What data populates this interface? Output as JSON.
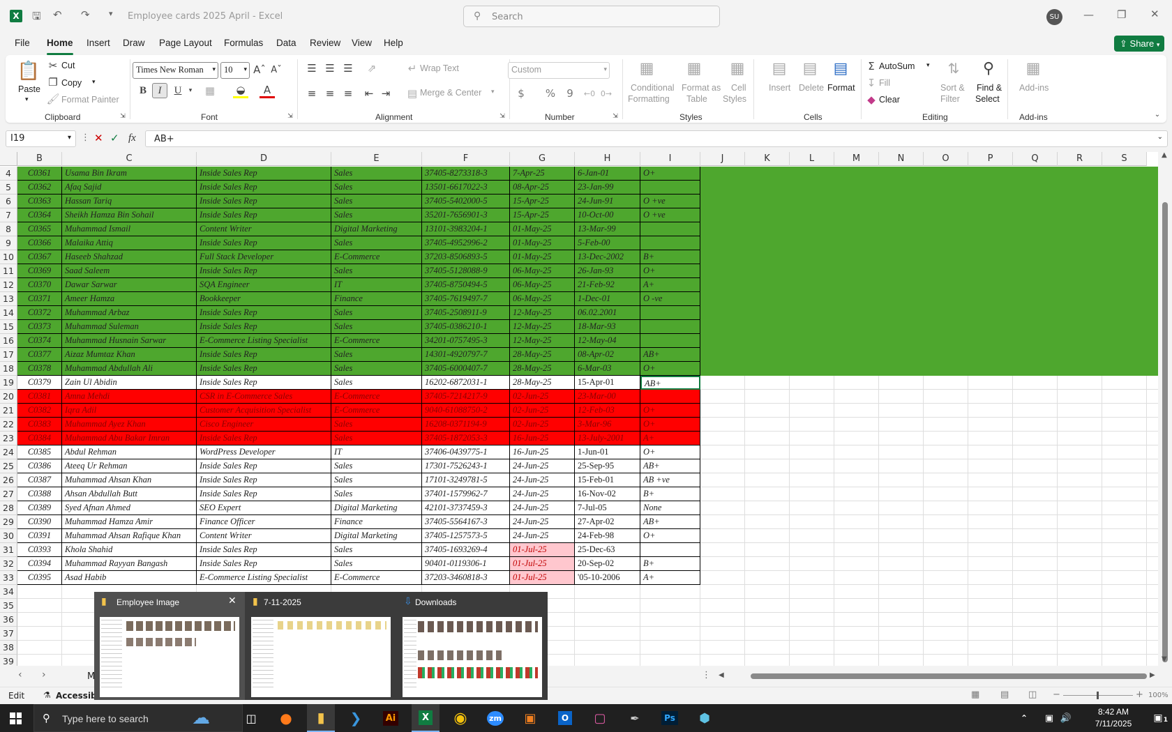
{
  "window": {
    "title": "Employee cards 2025 April  -  Excel",
    "search_placeholder": "Search",
    "user_initials": "SU",
    "share_label": "Share"
  },
  "menu": [
    "File",
    "Home",
    "Insert",
    "Draw",
    "Page Layout",
    "Formulas",
    "Data",
    "Review",
    "View",
    "Help"
  ],
  "ribbon": {
    "clipboard": {
      "paste": "Paste",
      "cut": "Cut",
      "copy": "Copy",
      "format_painter": "Format Painter",
      "group": "Clipboard"
    },
    "font": {
      "name": "Times New Roman",
      "size": "10",
      "group": "Font",
      "bold": "B",
      "italic": "I",
      "underline": "U"
    },
    "alignment": {
      "wrap": "Wrap Text",
      "merge": "Merge & Center",
      "group": "Alignment"
    },
    "number": {
      "format": "Custom",
      "group": "Number",
      "currency": "$",
      "percent": "%",
      "comma": "9"
    },
    "styles": {
      "conditional_1": "Conditional",
      "conditional_2": "Formatting",
      "format_table_1": "Format as",
      "format_table_2": "Table",
      "cell_styles_1": "Cell",
      "cell_styles_2": "Styles",
      "group": "Styles"
    },
    "cells": {
      "insert": "Insert",
      "delete": "Delete",
      "format": "Format",
      "group": "Cells"
    },
    "editing": {
      "autosum": "AutoSum",
      "fill": "Fill",
      "clear": "Clear",
      "sort_1": "Sort &",
      "sort_2": "Filter",
      "find_1": "Find &",
      "find_2": "Select",
      "group": "Editing"
    },
    "addins": {
      "label": "Add-ins",
      "group": "Add-ins"
    }
  },
  "formula": {
    "name_box": "I19",
    "fx": "fx",
    "value": "AB+"
  },
  "columns": [
    "B",
    "C",
    "D",
    "E",
    "F",
    "G",
    "H",
    "I",
    "J",
    "K",
    "L",
    "M",
    "N",
    "O",
    "P",
    "Q",
    "R",
    "S"
  ],
  "rows": [
    {
      "n": "4",
      "b": "C0361",
      "c": "Usama Bin Ikram",
      "d": "Inside Sales Rep",
      "e": "Sales",
      "f": "37405-8273318-3",
      "g": "7-Apr-25",
      "h": "6-Jan-01",
      "i": "O+",
      "fill": "green"
    },
    {
      "n": "5",
      "b": "C0362",
      "c": "Afaq Sajid",
      "d": "Inside Sales Rep",
      "e": "Sales",
      "f": "13501-6617022-3",
      "g": "08-Apr-25",
      "h": "23-Jan-99",
      "i": "",
      "fill": "green"
    },
    {
      "n": "6",
      "b": "C0363",
      "c": "Hassan Tariq",
      "d": "Inside Sales Rep",
      "e": "Sales",
      "f": "37405-5402000-5",
      "g": "15-Apr-25",
      "h": "24-Jun-91",
      "i": "O +ve",
      "fill": "green"
    },
    {
      "n": "7",
      "b": "C0364",
      "c": "Sheikh Hamza Bin Sohail",
      "d": "Inside Sales Rep",
      "e": "Sales",
      "f": "35201-7656901-3",
      "g": "15-Apr-25",
      "h": "10-Oct-00",
      "i": "O +ve",
      "fill": "green"
    },
    {
      "n": "8",
      "b": "C0365",
      "c": "Muhammad Ismail",
      "d": "Content Writer",
      "e": "Digital Marketing",
      "f": "13101-3983204-1",
      "g": "01-May-25",
      "h": "13-Mar-99",
      "i": "",
      "fill": "green"
    },
    {
      "n": "9",
      "b": "C0366",
      "c": "Malaika Attiq",
      "d": "Inside Sales Rep",
      "e": "Sales",
      "f": "37405-4952996-2",
      "g": "01-May-25",
      "h": "5-Feb-00",
      "i": "",
      "fill": "green"
    },
    {
      "n": "10",
      "b": "C0367",
      "c": "Haseeb Shahzad",
      "d": "Full Stack Developer",
      "e": "E-Commerce",
      "f": "37203-8506893-5",
      "g": "01-May-25",
      "h": "13-Dec-2002",
      "i": "B+",
      "fill": "green"
    },
    {
      "n": "11",
      "b": "C0369",
      "c": "Saad Saleem",
      "d": "Inside Sales Rep",
      "e": "Sales",
      "f": "37405-5128088-9",
      "g": "06-May-25",
      "h": "26-Jan-93",
      "i": "O+",
      "fill": "green"
    },
    {
      "n": "12",
      "b": "C0370",
      "c": "Dawar Sarwar",
      "d": "SQA Engineer",
      "e": "IT",
      "f": "37405-8750494-5",
      "g": "06-May-25",
      "h": "21-Feb-92",
      "i": "A+",
      "fill": "green"
    },
    {
      "n": "13",
      "b": "C0371",
      "c": "Ameer Hamza",
      "d": "Bookkeeper",
      "e": "Finance",
      "f": "37405-7619497-7",
      "g": "06-May-25",
      "h": "1-Dec-01",
      "i": "O -ve",
      "fill": "green"
    },
    {
      "n": "14",
      "b": "C0372",
      "c": "Muhammad Arbaz",
      "d": "Inside Sales Rep",
      "e": "Sales",
      "f": "37405-2508911-9",
      "g": "12-May-25",
      "h": "06.02.2001",
      "i": "",
      "fill": "green"
    },
    {
      "n": "15",
      "b": "C0373",
      "c": "Muhammad Suleman",
      "d": "Inside Sales Rep",
      "e": "Sales",
      "f": "37405-0386210-1",
      "g": "12-May-25",
      "h": "18-Mar-93",
      "i": "",
      "fill": "green"
    },
    {
      "n": "16",
      "b": "C0374",
      "c": "Muhammad Husnain Sarwar",
      "d": "E-Commerce Listing Specialist",
      "e": "E-Commerce",
      "f": "34201-0757495-3",
      "g": "12-May-25",
      "h": "12-May-04",
      "i": "",
      "fill": "green"
    },
    {
      "n": "17",
      "b": "C0377",
      "c": "Aizaz Mumtaz Khan",
      "d": "Inside Sales Rep",
      "e": "Sales",
      "f": "14301-4920797-7",
      "g": "28-May-25",
      "h": "08-Apr-02",
      "i": "AB+",
      "fill": "green"
    },
    {
      "n": "18",
      "b": "C0378",
      "c": "Muhammad Abdullah Ali",
      "d": "Inside Sales Rep",
      "e": "Sales",
      "f": "37405-6000407-7",
      "g": "28-May-25",
      "h": "6-Mar-03",
      "i": "O+",
      "fill": "green"
    },
    {
      "n": "19",
      "b": "C0379",
      "c": "Zain Ul Abidin",
      "d": "Inside Sales Rep",
      "e": "Sales",
      "f": "16202-6872031-1",
      "g": "28-May-25",
      "h": "15-Apr-01",
      "i": "AB+",
      "fill": "white"
    },
    {
      "n": "20",
      "b": "C0381",
      "c": "Amna Mehdi",
      "d": "CSR in E-Commerce Sales",
      "e": "E-Commerce",
      "f": "37405-7214217-9",
      "g": "02-Jun-25",
      "h": "23-Mar-00",
      "i": "",
      "fill": "red"
    },
    {
      "n": "21",
      "b": "C0382",
      "c": "Iqra Adil",
      "d": "Customer Acquisition Specialist",
      "e": "E-Commerce",
      "f": "9040-61088750-2",
      "g": "02-Jun-25",
      "h": "12-Feb-03",
      "i": "O+",
      "fill": "red"
    },
    {
      "n": "22",
      "b": "C0383",
      "c": "Muhammad Ayez Khan",
      "d": "Cisco Engineer",
      "e": "Sales",
      "f": "16208-0371194-9",
      "g": "02-Jun-25",
      "h": "3-Mar-96",
      "i": "O+",
      "fill": "red"
    },
    {
      "n": "23",
      "b": "C0384",
      "c": "Muhammad Abu Bakar Imran",
      "d": "Inside Sales Rep",
      "e": "Sales",
      "f": "37405-1872053-3",
      "g": "16-Jun-25",
      "h": "13-July-2001",
      "i": "A+",
      "fill": "red"
    },
    {
      "n": "24",
      "b": "C0385",
      "c": "Abdul Rehman",
      "d": "WordPress Developer",
      "e": "IT",
      "f": "37406-0439775-1",
      "g": "16-Jun-25",
      "h": "1-Jun-01",
      "i": "O+",
      "fill": "white"
    },
    {
      "n": "25",
      "b": "C0386",
      "c": "Ateeq Ur Rehman",
      "d": "Inside Sales Rep",
      "e": "Sales",
      "f": "17301-7526243-1",
      "g": "24-Jun-25",
      "h": "25-Sep-95",
      "i": "AB+",
      "fill": "white"
    },
    {
      "n": "26",
      "b": "C0387",
      "c": "Muhammad Ahsan Khan",
      "d": "Inside Sales Rep",
      "e": "Sales",
      "f": "17101-3249781-5",
      "g": "24-Jun-25",
      "h": "15-Feb-01",
      "i": "AB +ve",
      "fill": "white"
    },
    {
      "n": "27",
      "b": "C0388",
      "c": "Ahsan Abdullah Butt",
      "d": "Inside Sales Rep",
      "e": "Sales",
      "f": "37401-1579962-7",
      "g": "24-Jun-25",
      "h": "16-Nov-02",
      "i": "B+",
      "fill": "white"
    },
    {
      "n": "28",
      "b": "C0389",
      "c": "Syed Afnan Ahmed",
      "d": "SEO Expert",
      "e": "Digital Marketing",
      "f": "42101-3737459-3",
      "g": "24-Jun-25",
      "h": "7-Jul-05",
      "i": "None",
      "fill": "white"
    },
    {
      "n": "29",
      "b": "C0390",
      "c": "Muhammad Hamza Amir",
      "d": "Finance Officer",
      "e": "Finance",
      "f": "37405-5564167-3",
      "g": "24-Jun-25",
      "h": "27-Apr-02",
      "i": "AB+",
      "fill": "white"
    },
    {
      "n": "30",
      "b": "C0391",
      "c": "Muhammad Ahsan Rafique Khan",
      "d": "Content Writer",
      "e": "Digital Marketing",
      "f": "37405-1257573-5",
      "g": "24-Jun-25",
      "h": "24-Feb-98",
      "i": "O+",
      "fill": "white"
    },
    {
      "n": "31",
      "b": "C0393",
      "c": "Khola Shahid",
      "d": "Inside Sales Rep",
      "e": "Sales",
      "f": "37405-1693269-4",
      "g": "01-Jul-25",
      "h": "25-Dec-63",
      "i": "",
      "fill": "white",
      "gpink": true
    },
    {
      "n": "32",
      "b": "C0394",
      "c": "Muhammad Rayyan Bangash",
      "d": "Inside Sales Rep",
      "e": "Sales",
      "f": "90401-0119306-1",
      "g": "01-Jul-25",
      "h": "20-Sep-02",
      "i": "B+",
      "fill": "white",
      "gpink": true
    },
    {
      "n": "33",
      "b": "C0395",
      "c": "Asad Habib",
      "d": "E-Commerce Listing Specialist",
      "e": "E-Commerce",
      "f": "37203-3460818-3",
      "g": "01-Jul-25",
      "h": "'05-10-2006",
      "i": "A+",
      "fill": "white",
      "gpink": true
    }
  ],
  "empty_rows": [
    "34",
    "35",
    "36",
    "37",
    "38",
    "39"
  ],
  "switcher": [
    {
      "title": "Employee Image"
    },
    {
      "title": "7-11-2025"
    },
    {
      "title": "Downloads"
    }
  ],
  "sheet_tab_partial": "M",
  "status": {
    "mode": "Edit",
    "accessibility": "Accessibili",
    "zoom": "100%"
  },
  "taskbar": {
    "search_placeholder": "Type here to search",
    "time": "8:42 AM",
    "date": "7/11/2025",
    "notif_count": "1"
  },
  "colors": {
    "green": "#4ea72e",
    "red": "#ff0000",
    "pink": "#ffc7ce",
    "excel": "#107c41"
  }
}
